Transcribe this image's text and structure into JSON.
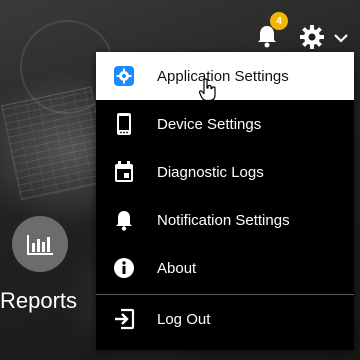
{
  "notifications": {
    "count": "4"
  },
  "tile": {
    "label": "Reports"
  },
  "menu": {
    "items": [
      {
        "label": "Application Settings",
        "icon": "app-settings-icon",
        "active": true
      },
      {
        "label": "Device Settings",
        "icon": "device-icon",
        "active": false
      },
      {
        "label": "Diagnostic Logs",
        "icon": "calendar-log-icon",
        "active": false
      },
      {
        "label": "Notification Settings",
        "icon": "bell-icon",
        "active": false
      },
      {
        "label": "About",
        "icon": "info-icon",
        "active": false
      }
    ],
    "logout": {
      "label": "Log Out",
      "icon": "logout-icon"
    }
  },
  "colors": {
    "accent": "#1a8cff",
    "badge": "#f2b705",
    "menu_bg": "#000000",
    "active_bg": "#ffffff"
  }
}
